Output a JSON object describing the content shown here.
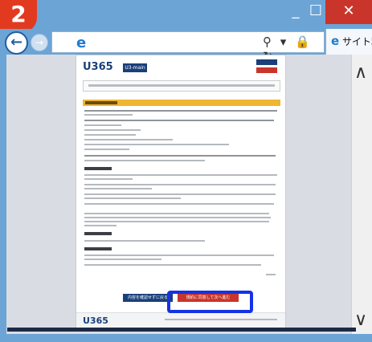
{
  "step_badge": "2",
  "window": {
    "minimize_icon": "minimize-icon",
    "maximize_icon": "maximize-icon",
    "close_icon": "close-icon",
    "minimize_glyph": "_",
    "maximize_glyph": "☐",
    "close_glyph": "✕"
  },
  "nav": {
    "back_glyph": "←",
    "forward_glyph": "→",
    "ie_glyph": "e",
    "address_icons": "⚲ ▾ 🔒 ↻",
    "tab_icon_glyph": "e",
    "tab_label": "サイト利用"
  },
  "page": {
    "logo": "U365",
    "header_badge": "U3-main",
    "back_button_label": "内容を確認せずに戻る",
    "agree_button_label": "規約に同意して次へ進む",
    "footer_logo": "U365"
  },
  "colors": {
    "titlebar": "#6ca4d6",
    "badge": "#e23a1f",
    "close": "#c9352b",
    "highlight_outline": "#1432e6",
    "section_head": "#f0b630",
    "navy": "#1a3f7a"
  }
}
